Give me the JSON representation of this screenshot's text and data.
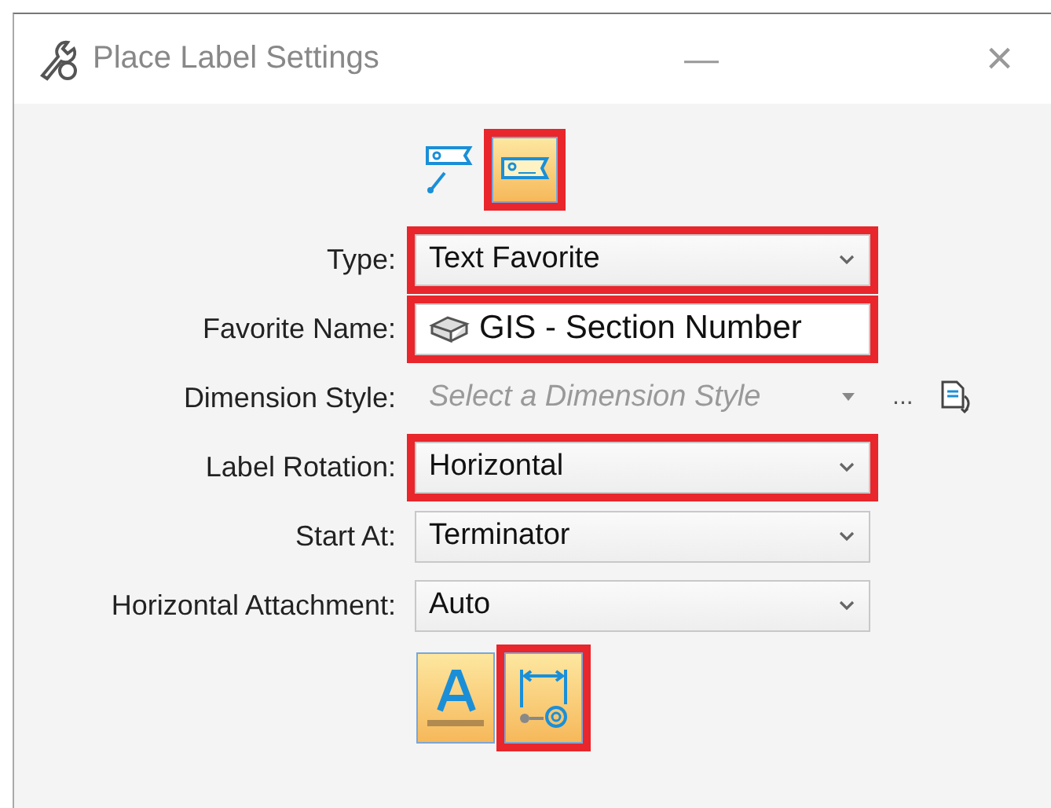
{
  "window": {
    "title": "Place Label Settings",
    "minimize": "—",
    "close": "×"
  },
  "mode_buttons": [
    {
      "kind": "label-line",
      "selected": false,
      "highlighted": false
    },
    {
      "kind": "label",
      "selected": true,
      "highlighted": true
    }
  ],
  "fields": [
    {
      "label": "Type:",
      "kind": "dropdown",
      "value": "Text Favorite",
      "disabled": false,
      "highlighted": true
    },
    {
      "label": "Favorite Name:",
      "kind": "favorite",
      "value": "GIS - Section Number",
      "disabled": false,
      "highlighted": true
    },
    {
      "label": "Dimension Style:",
      "kind": "style-picker",
      "placeholder": "Select a Dimension Style",
      "more": "...",
      "disabled": true,
      "highlighted": false
    },
    {
      "label": "Label Rotation:",
      "kind": "dropdown",
      "value": "Horizontal",
      "disabled": false,
      "highlighted": true
    },
    {
      "label": "Start At:",
      "kind": "dropdown",
      "value": "Terminator",
      "disabled": false,
      "highlighted": false
    },
    {
      "label": "Horizontal Attachment:",
      "kind": "dropdown",
      "value": "Auto",
      "disabled": false,
      "highlighted": false
    }
  ],
  "bottom_buttons": [
    {
      "kind": "text-style",
      "selected": true,
      "highlighted": false
    },
    {
      "kind": "dimension",
      "selected": true,
      "highlighted": true
    }
  ]
}
